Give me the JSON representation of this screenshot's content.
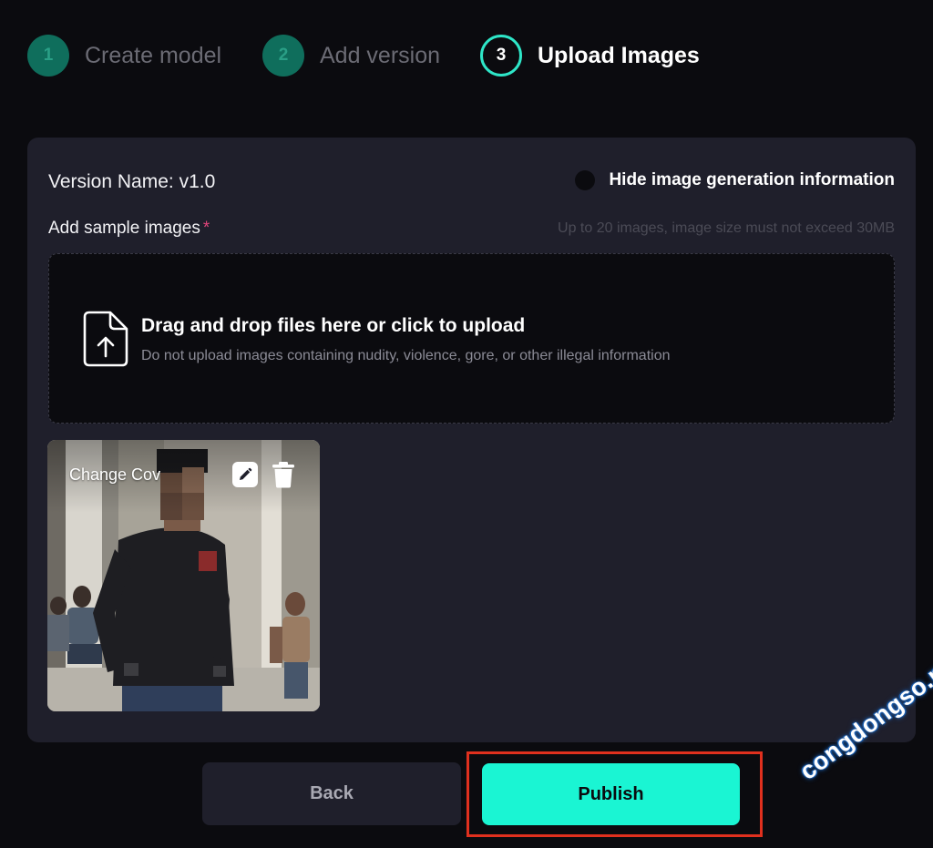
{
  "stepper": {
    "steps": [
      {
        "number": "1",
        "label": "Create model",
        "state": "done"
      },
      {
        "number": "2",
        "label": "Add version",
        "state": "done"
      },
      {
        "number": "3",
        "label": "Upload Images",
        "state": "active"
      }
    ]
  },
  "card": {
    "version_name": "Version Name: v1.0",
    "hide_info_label": "Hide image generation information",
    "add_images_label": "Add sample images",
    "required_mark": "*",
    "limit_hint": "Up to 20 images, image size must not exceed 30MB",
    "dropzone": {
      "title": "Drag and drop files here or click to upload",
      "subtitle": "Do not upload images containing nudity, violence, gore, or other illegal information"
    },
    "thumbnail": {
      "change_cover_label": "Change Cover"
    }
  },
  "actions": {
    "back_label": "Back",
    "publish_label": "Publish"
  },
  "watermark": "congdongso.net",
  "colors": {
    "accent": "#1af5d3",
    "step_done": "#0f6e5c",
    "highlight_box": "#e0301e",
    "required": "#e0457b"
  },
  "icons": {
    "upload": "file-upload-icon",
    "edit": "pencil-icon",
    "delete": "trash-icon"
  }
}
